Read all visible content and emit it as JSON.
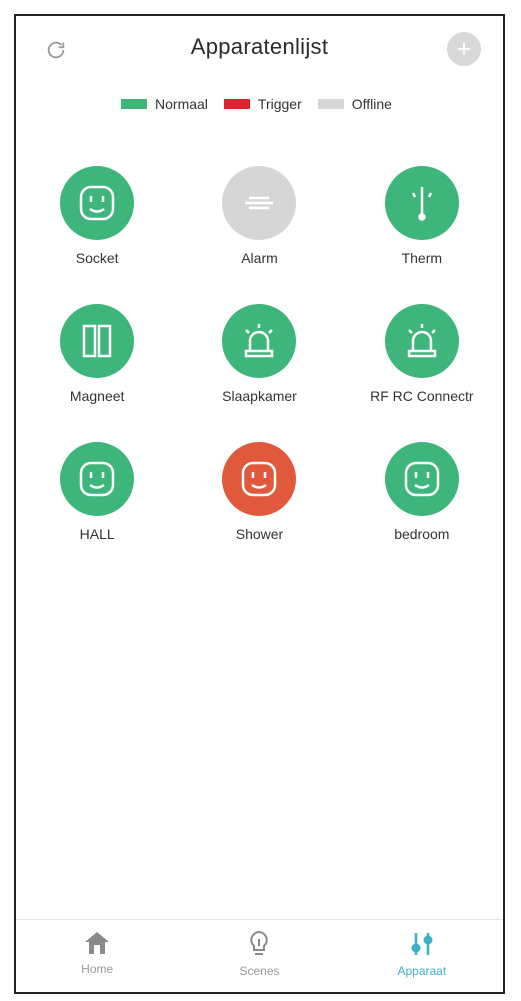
{
  "header": {
    "title": "Apparatenlijst",
    "refresh_icon": "refresh-icon",
    "add_icon": "add-icon"
  },
  "legend": [
    {
      "label": "Normaal",
      "color": "#3db57b"
    },
    {
      "label": "Trigger",
      "color": "#d9252b"
    },
    {
      "label": "Offline",
      "color": "#d6d6d6"
    }
  ],
  "devices": [
    {
      "label": "Socket",
      "status": "normal",
      "icon": "socket-icon"
    },
    {
      "label": "Alarm",
      "status": "offline",
      "icon": "alarm-icon"
    },
    {
      "label": "Therm",
      "status": "normal",
      "icon": "thermometer-icon"
    },
    {
      "label": "Magneet",
      "status": "normal",
      "icon": "door-magnet-icon"
    },
    {
      "label": "Slaapkamer",
      "status": "normal",
      "icon": "siren-icon"
    },
    {
      "label": "RF RC Connectr",
      "status": "normal",
      "icon": "siren-icon"
    },
    {
      "label": "HALL",
      "status": "normal",
      "icon": "socket-icon"
    },
    {
      "label": "Shower",
      "status": "trigger",
      "icon": "socket-icon"
    },
    {
      "label": "bedroom",
      "status": "normal",
      "icon": "socket-icon"
    }
  ],
  "status_colors": {
    "normal": "#3db57b",
    "trigger": "#e0593d",
    "offline": "#d6d6d6"
  },
  "tabs": [
    {
      "label": "Home",
      "icon": "home-icon",
      "active": false
    },
    {
      "label": "Scenes",
      "icon": "bulb-icon",
      "active": false
    },
    {
      "label": "Apparaat",
      "icon": "devices-icon",
      "active": true
    }
  ]
}
